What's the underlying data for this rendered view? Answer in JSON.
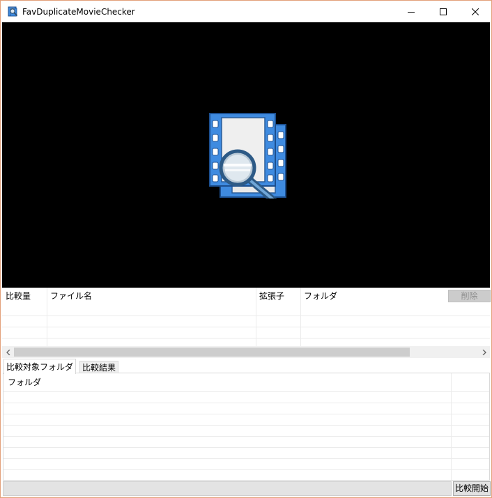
{
  "window": {
    "title": "FavDuplicateMovieChecker"
  },
  "icons": {
    "app": "film-magnifier-icon",
    "minimize": "minimize-icon",
    "maximize": "maximize-icon",
    "close": "close-icon",
    "logo": "film-magnifier-logo",
    "scroll_left": "chevron-left-icon",
    "scroll_right": "chevron-right-icon"
  },
  "colors": {
    "preview_background": "#000000",
    "window_border": "#e2a07a",
    "logo_blue": "#3f8be0"
  },
  "file_table": {
    "columns": [
      "比較量",
      "ファイル名",
      "拡張子",
      "フォルダ"
    ],
    "delete_label": "削除"
  },
  "tabs": [
    "比較対象フォルダ",
    "比較結果"
  ],
  "folder_list": {
    "header": "フォルダ"
  },
  "actions": {
    "start_label": "比較開始"
  }
}
